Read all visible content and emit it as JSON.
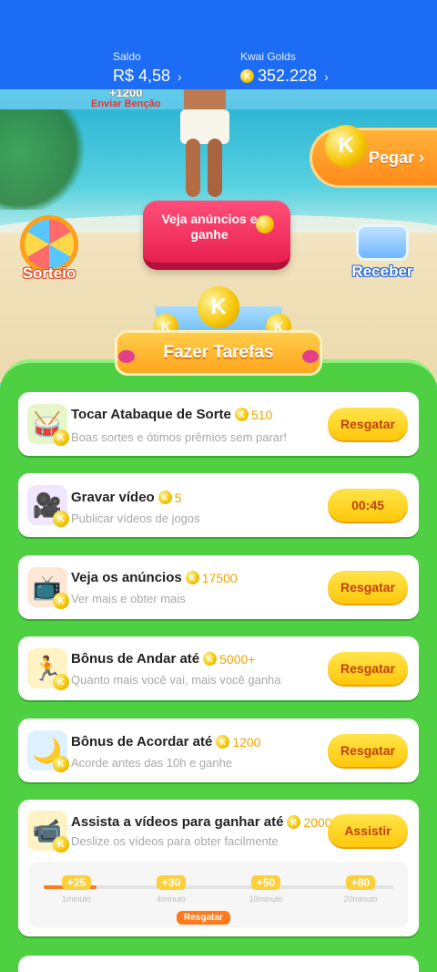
{
  "header": {
    "saldo": {
      "label": "Saldo",
      "value": "R$ 4,58"
    },
    "golds": {
      "label": "Kwai Golds",
      "value": "352.228"
    }
  },
  "scene": {
    "blessing_amount": "+1200",
    "blessing_label": "Enviar Benção",
    "pegar_label": "Pegar",
    "ad_button": "Veja anúncios e ganhe",
    "sorteio_label": "Sorteio",
    "receber_label": "Receber",
    "banner_label": "Fazer Tarefas",
    "coin_letter": "K"
  },
  "tasks": [
    {
      "title": "Tocar Atabaque de Sorte",
      "reward": "510",
      "desc": "Boas sortes e ótimos prêmios sem parar!",
      "button": "Resgatar",
      "icon": "drum-icon"
    },
    {
      "title": "Gravar vídeo",
      "reward": "5",
      "desc": "Publicar vídeos de jogos",
      "button": "00:45",
      "icon": "video-record-icon"
    },
    {
      "title": "Veja os anúncios",
      "reward": "17500",
      "desc": "Ver mais e obter mais",
      "button": "Resgatar",
      "icon": "tv-icon"
    },
    {
      "title": "Bônus de Andar até",
      "reward": "5000+",
      "desc": "Quanto mais você vai, mais você ganha",
      "button": "Resgatar",
      "icon": "walking-boy-icon"
    },
    {
      "title": "Bônus de Acordar até",
      "reward": "1200",
      "desc": "Acorde antes das 10h e ganhe",
      "button": "Resgatar",
      "icon": "moon-icon"
    },
    {
      "title": "Assista a vídeos para ganhar até",
      "reward": "2000",
      "desc": "Deslize os vídeos para obter facilmente",
      "button": "Assistir",
      "icon": "camera-icon"
    }
  ],
  "watch_progress": {
    "progress": 0.15,
    "milestones": [
      {
        "reward": "+25",
        "time": "1minuto"
      },
      {
        "reward": "+30",
        "time": "4minuto"
      },
      {
        "reward": "+50",
        "time": "10minuto"
      },
      {
        "reward": "+80",
        "time": "20minuto"
      }
    ],
    "claim_label": "Resgatar"
  },
  "colors": {
    "header_blue": "#1d6cf5",
    "panel_green": "#4fd042",
    "button_yellow": "#ffd21f",
    "reward_gold": "#f2a400"
  }
}
